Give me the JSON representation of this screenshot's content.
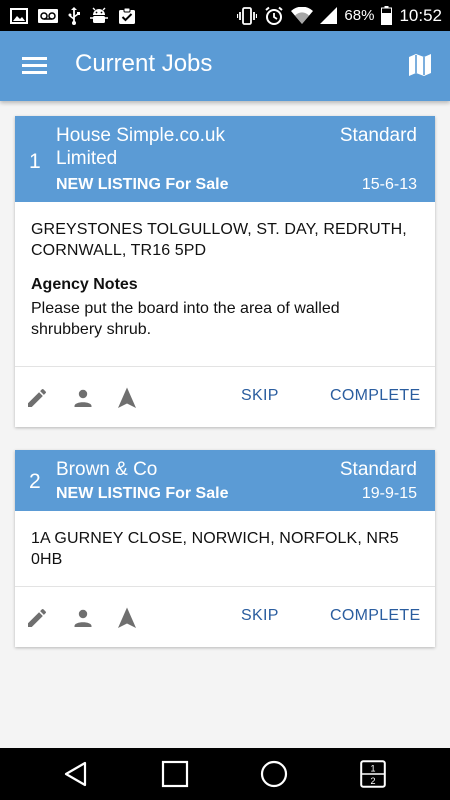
{
  "status_bar": {
    "battery_percent": "68%",
    "time": "10:52",
    "icons": [
      "image-icon",
      "voicemail-icon",
      "usb-icon",
      "android-debug-icon",
      "clipboard-check-icon",
      "vibrate-icon",
      "alarm-icon",
      "wifi-icon",
      "signal-icon",
      "battery-icon"
    ]
  },
  "app_bar": {
    "title": "Current Jobs",
    "icons": [
      "menu-icon",
      "map-icon"
    ]
  },
  "jobs": [
    {
      "number": "1",
      "company_line1": "House Simple.co.uk",
      "company_line2": "Limited",
      "type": "Standard",
      "listing": "NEW LISTING For Sale",
      "date": "15-6-13",
      "address_line1": "GREYSTONES TOLGULLOW, ST. DAY, REDRUTH,",
      "address_line2": "CORNWALL, TR16 5PD",
      "notes_title": "Agency Notes",
      "notes_line1": "Please put the board into the area of walled",
      "notes_line2": "shrubbery shrub.",
      "skip_label": "SKIP",
      "complete_label": "COMPLETE"
    },
    {
      "number": "2",
      "company_line1": "Brown & Co",
      "type": "Standard",
      "listing": "NEW LISTING For Sale",
      "date": "19-9-15",
      "address_line1": "1A GURNEY CLOSE, NORWICH, NORFOLK, NR5",
      "address_line2": "0HB",
      "skip_label": "SKIP",
      "complete_label": "COMPLETE"
    }
  ],
  "action_icons": [
    "edit-icon",
    "person-icon",
    "navigation-icon"
  ],
  "nav_bar": {
    "icons": [
      "back-icon",
      "home-icon",
      "recents-icon",
      "split-screen-icon"
    ],
    "split_screen_top": "1",
    "split_screen_bottom": "2"
  },
  "colors": {
    "primary": "#5b9bd5",
    "button_text": "#2a5d9f",
    "background": "#f4f4f4",
    "icon_grey": "#6f6f6f"
  }
}
